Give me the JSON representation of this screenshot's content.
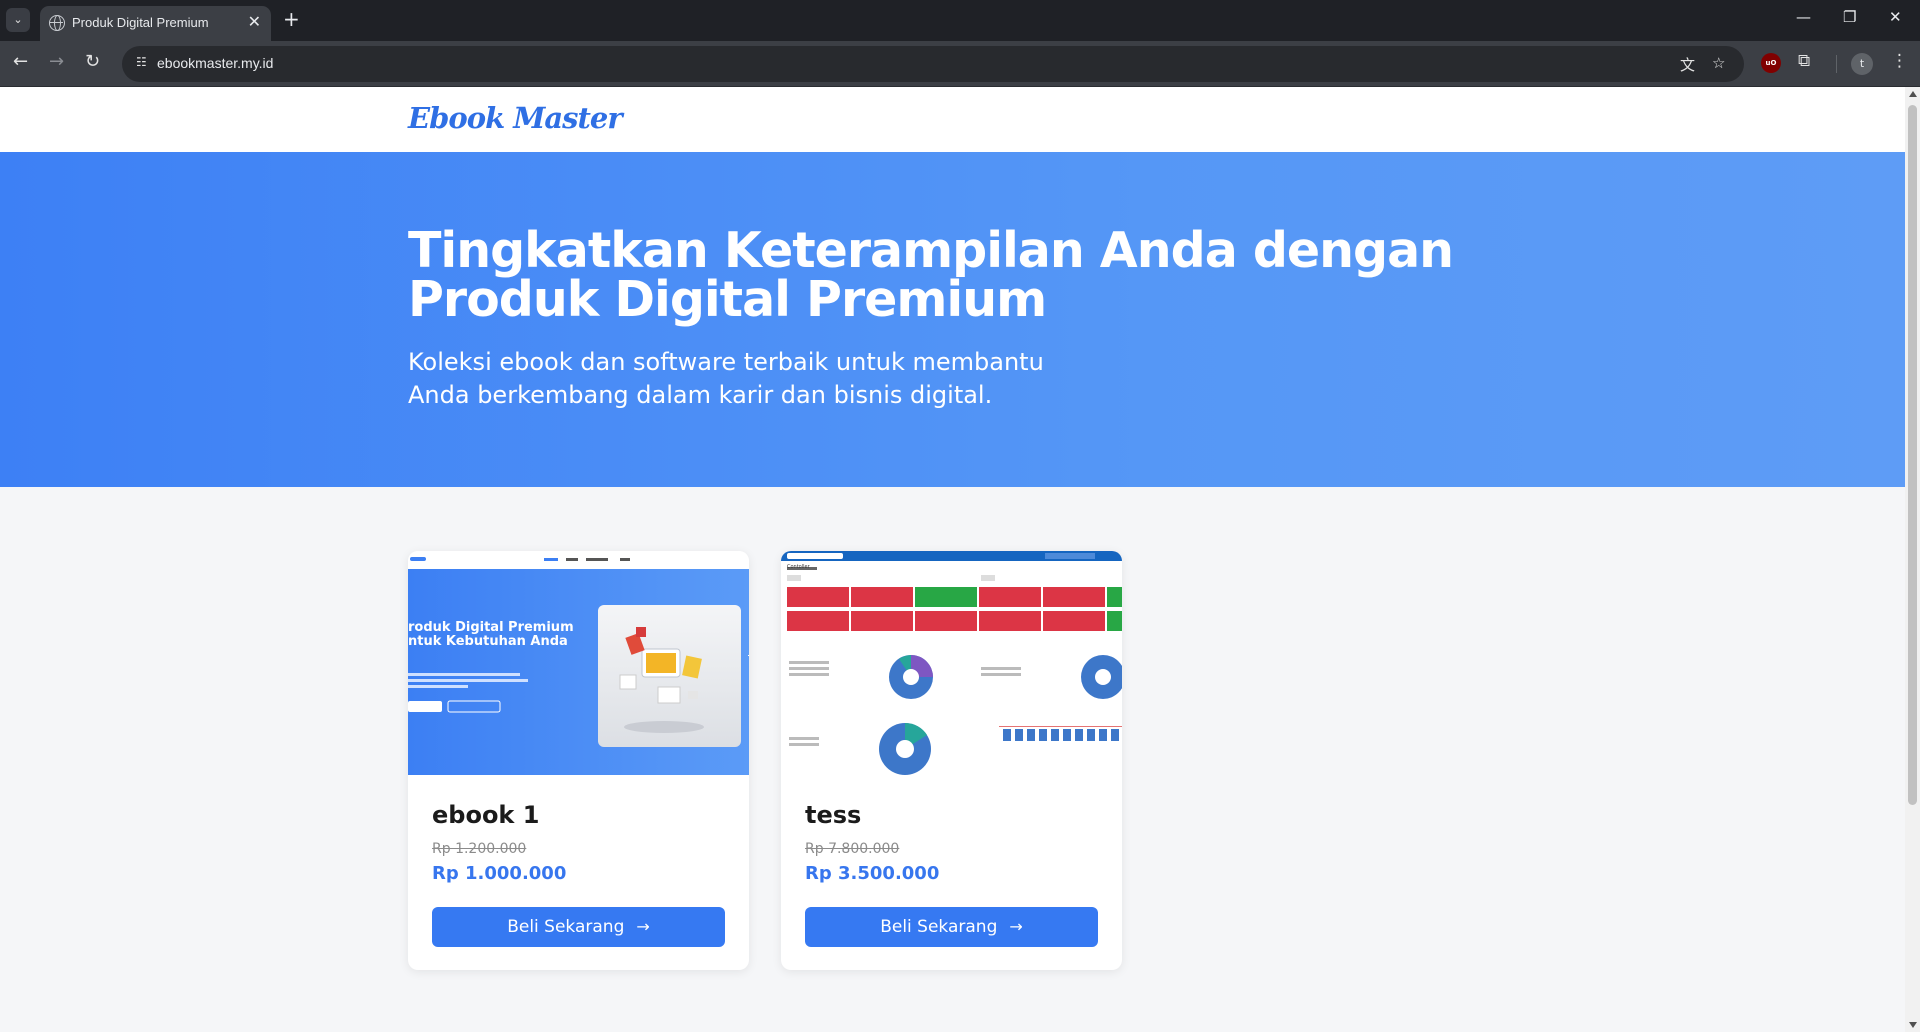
{
  "browser": {
    "tab_title": "Produk Digital Premium",
    "url": "ebookmaster.my.id",
    "profile_initial": "t",
    "ublock_label": "uO"
  },
  "site": {
    "logo": "Ebook Master",
    "hero_title": "Tingkatkan Keterampilan Anda dengan Produk Digital Premium",
    "hero_subtitle_line1": "Koleksi ebook dan software terbaik untuk membantu",
    "hero_subtitle_line2": "Anda berkembang dalam karir dan bisnis digital."
  },
  "products": [
    {
      "name": "ebook 1",
      "old_price": "Rp 1.200.000",
      "price": "Rp 1.000.000",
      "button": "Beli Sekarang",
      "thumb_title_1": "roduk Digital Premium",
      "thumb_title_2": "ntuk Kebutuhan Anda"
    },
    {
      "name": "tess",
      "old_price": "Rp 7.800.000",
      "price": "Rp 3.500.000",
      "button": "Beli Sekarang",
      "thumb_label": "Contoller"
    }
  ],
  "colors": {
    "accent": "#3679f2",
    "hero_start": "#3d80f5",
    "hero_end": "#5e9cf6"
  }
}
